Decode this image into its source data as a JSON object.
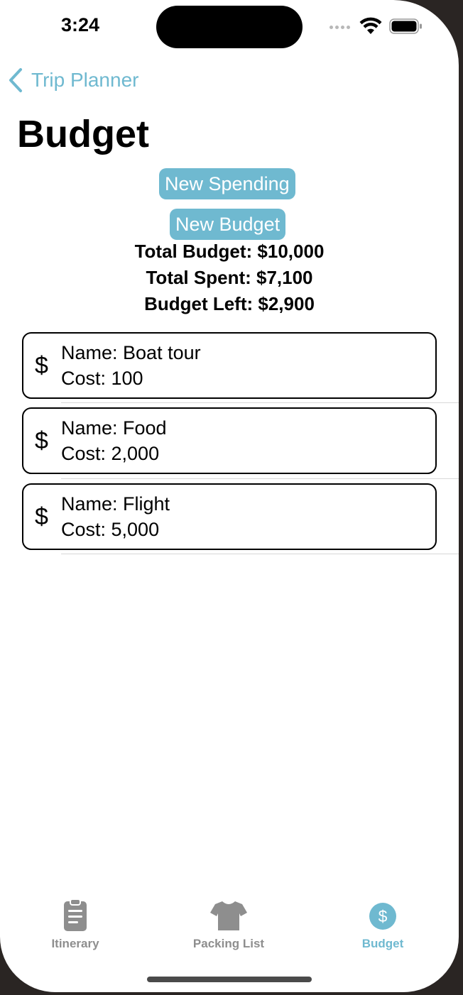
{
  "status_bar": {
    "time": "3:24"
  },
  "nav": {
    "back_label": "Trip Planner",
    "title": "Budget"
  },
  "actions": {
    "new_spending_label": "New Spending",
    "new_budget_label": "New Budget"
  },
  "summary": {
    "total_budget": "Total Budget: $10,000",
    "total_spent": "Total Spent: $7,100",
    "budget_left": "Budget Left: $2,900"
  },
  "spending_items": [
    {
      "icon": "dollar-sign-icon",
      "name_line": "Name: Boat tour",
      "cost_line": "Cost: 100"
    },
    {
      "icon": "dollar-sign-icon",
      "name_line": "Name: Food",
      "cost_line": "Cost: 2,000"
    },
    {
      "icon": "dollar-sign-icon",
      "name_line": "Name: Flight",
      "cost_line": "Cost: 5,000"
    }
  ],
  "tab_bar": {
    "tabs": [
      {
        "label": "Itinerary",
        "icon": "clipboard-icon",
        "selected": false
      },
      {
        "label": "Packing List",
        "icon": "tshirt-icon",
        "selected": false
      },
      {
        "label": "Budget",
        "icon": "dollar-circle-icon",
        "selected": true
      }
    ]
  },
  "colors": {
    "accent": "#6fb9d0",
    "inactive_tab": "#8e8e8e"
  }
}
